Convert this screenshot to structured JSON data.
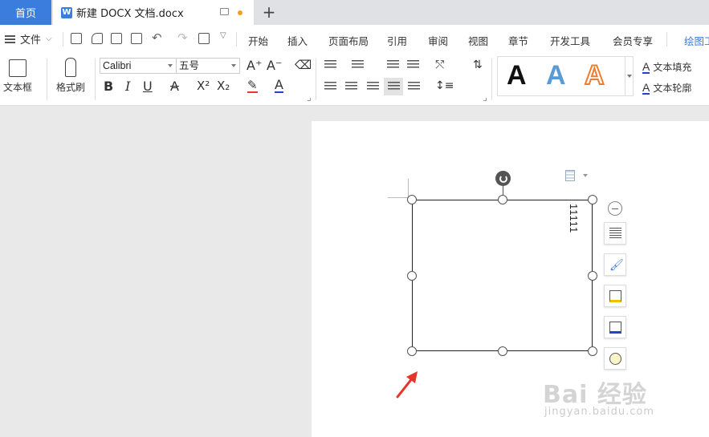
{
  "tabs": {
    "home": "首页",
    "doc_title": "新建 DOCX 文档.docx",
    "doc_icon": "W"
  },
  "menu": {
    "file": "文件",
    "items": [
      "开始",
      "插入",
      "页面布局",
      "引用",
      "审阅",
      "视图",
      "章节",
      "开发工具",
      "会员专享",
      "绘图工"
    ]
  },
  "ribbon": {
    "textbox_label": "文本框",
    "format_painter": "格式刷",
    "font_name": "Calibri",
    "font_size": "五号",
    "text_fill": "文本填充",
    "text_outline": "文本轮廓",
    "style_letter": "A"
  },
  "document": {
    "textbox_text": "11111"
  },
  "watermark": {
    "brand": "Bai 经验",
    "url": "jingyan.baidu.com"
  },
  "colors": {
    "accent": "#3b7ddd",
    "arrow": "#e8352a",
    "style_black": "#111111",
    "style_blue": "#5b9bd5",
    "style_orange": "#ed7d31"
  }
}
